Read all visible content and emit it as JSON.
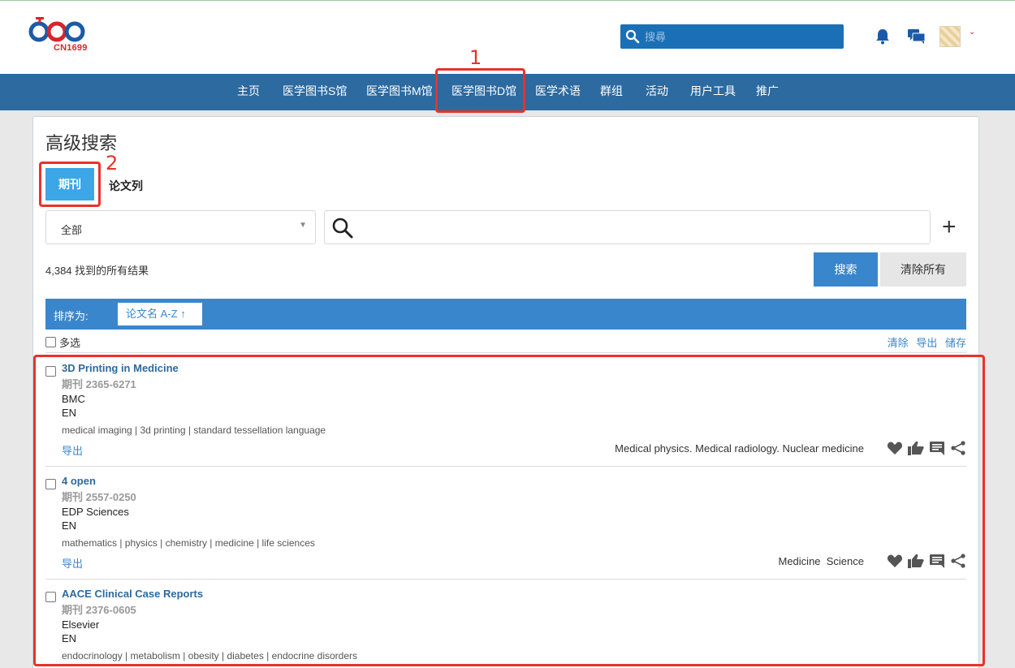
{
  "header": {
    "logo_text": "CN1699",
    "search_placeholder": "搜尋"
  },
  "nav": {
    "items": [
      "主页",
      "医学图书S馆",
      "医学图书M馆",
      "医学图书D馆",
      "医学术语",
      "群组",
      "活动",
      "用户工具",
      "推广"
    ]
  },
  "annotations": {
    "label_1": "1",
    "label_2": "2",
    "color": "#e8322b"
  },
  "page": {
    "title": "高级搜索",
    "tab_active": "期刊",
    "tab_other": "论文列",
    "select_value": "全部",
    "result_count": "4,384 找到的所有结果",
    "search_button": "搜索",
    "clear_button": "清除所有",
    "sort_label": "排序为:",
    "sort_value": "论文名 A-Z",
    "multi_select": "多选",
    "action_clear": "清除",
    "action_export": "导出",
    "action_save": "储存"
  },
  "results": [
    {
      "title": "3D Printing in Medicine",
      "issn": "期刊 2365-6271",
      "publisher": "BMC",
      "lang": "EN",
      "keywords": "medical imaging | 3d printing | standard tessellation language",
      "export": "导出",
      "categories": "Medical physics. Medical radiology. Nuclear medicine"
    },
    {
      "title": "4 open",
      "issn": "期刊 2557-0250",
      "publisher": "EDP Sciences",
      "lang": "EN",
      "keywords": "mathematics | physics | chemistry | medicine | life sciences",
      "export": "导出",
      "categories": "Medicine  Science"
    },
    {
      "title": "AACE Clinical Case Reports",
      "issn": "期刊 2376-0605",
      "publisher": "Elsevier",
      "lang": "EN",
      "keywords": "endocrinology | metabolism | obesity | diabetes | endocrine disorders",
      "export": "",
      "categories": ""
    }
  ],
  "colors": {
    "nav_bg": "#2c6aa0",
    "accent": "#3a86cc",
    "tab_active": "#3ca6e6"
  }
}
